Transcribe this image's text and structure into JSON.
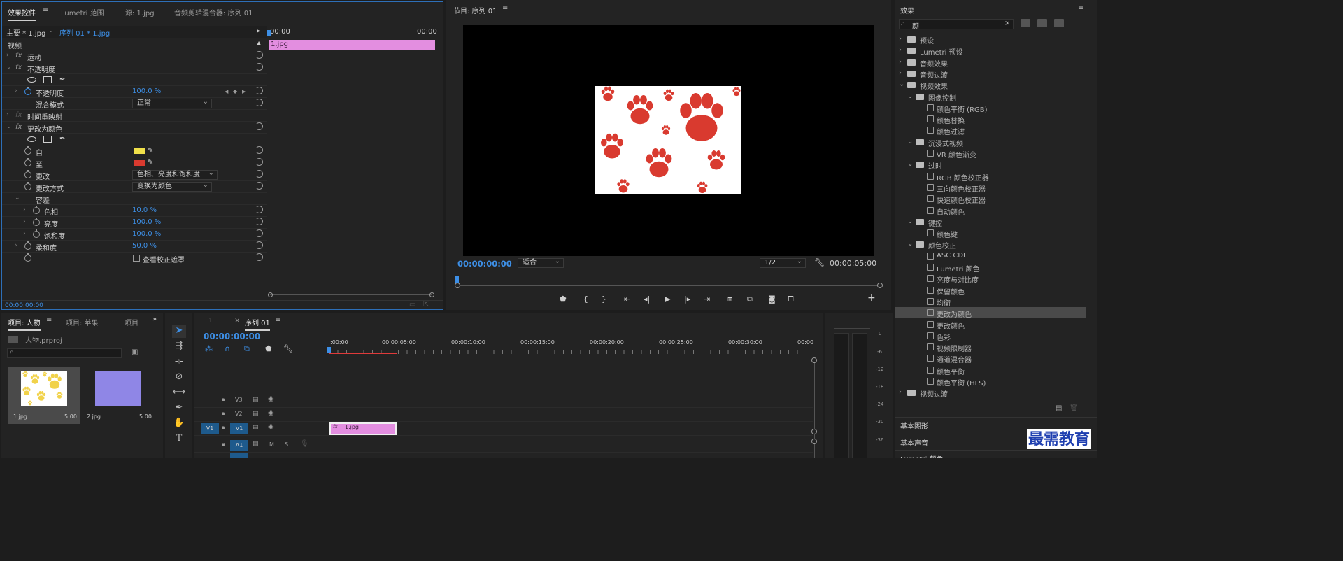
{
  "effect_controls": {
    "tabs": [
      "效果控件",
      "Lumetri 范围",
      "源: 1.jpg",
      "音频剪辑混合器: 序列 01"
    ],
    "master_label": "主要 * 1.jpg",
    "sequence_label": "序列 01 * 1.jpg",
    "section_video": "视频",
    "ruler_start": "00:00",
    "ruler_end": "00:00",
    "clip_name": "1.jpg",
    "motion": "运动",
    "opacity": "不透明度",
    "opacity_param": "不透明度",
    "opacity_value": "100.0 %",
    "blend_mode_label": "混合模式",
    "blend_mode_value": "正常",
    "time_remap": "时间重映射",
    "change_to_color": "更改为颜色",
    "from_label": "自",
    "to_label": "至",
    "from_color": "#f0e04a",
    "to_color": "#d93a2f",
    "change_label": "更改",
    "change_value": "色相、亮度和饱和度",
    "change_by_label": "更改方式",
    "change_by_value": "变换为颜色",
    "tolerance_label": "容差",
    "hue_label": "色相",
    "hue_value": "10.0 %",
    "lightness_label": "亮度",
    "lightness_value": "100.0 %",
    "saturation_label": "饱和度",
    "saturation_value": "100.0 %",
    "softness_label": "柔和度",
    "softness_value": "50.0 %",
    "view_matte_label": "查看校正遮罩",
    "timecode": "00:00:00:00"
  },
  "program_monitor": {
    "title": "节目: 序列 01",
    "timecode_left": "00:00:00:00",
    "fit_value": "适合",
    "resolution_value": "1/2",
    "timecode_right": "00:00:05:00",
    "image_bg": "#ffffff",
    "paw_color": "#d93a2f"
  },
  "project_panel": {
    "tabs": [
      "项目: 人物",
      "项目: 苹果",
      "项目"
    ],
    "project_file": "人物.prproj",
    "items": [
      {
        "name": "1.jpg",
        "duration": "5:00"
      },
      {
        "name": "2.jpg",
        "duration": "5:00"
      }
    ],
    "thumb2_color": "#8f86e6",
    "thumb1_paw_color": "#f1d24a"
  },
  "timeline": {
    "tab_1": "1",
    "tab_seq": "序列 01",
    "timecode": "00:00:00:00",
    "ruler": [
      ":00:00",
      "00:00:05:00",
      "00:00:10:00",
      "00:00:15:00",
      "00:00:20:00",
      "00:00:25:00",
      "00:00:30:00",
      "00:00"
    ],
    "tracks": [
      "V3",
      "V2",
      "V1",
      "A1"
    ],
    "source_v1": "V1",
    "track_m": "M",
    "track_s": "S",
    "clip_name": "1.jpg",
    "clip_fx": "fx"
  },
  "meter": {
    "scale": [
      "0",
      "-6",
      "-12",
      "-18",
      "-24",
      "-30",
      "-36"
    ]
  },
  "effects_panel": {
    "title": "效果",
    "search_value": "颜",
    "tree": [
      {
        "label": "预设",
        "level": 0,
        "kind": "folder-star"
      },
      {
        "label": "Lumetri 预设",
        "level": 0,
        "kind": "folder-star"
      },
      {
        "label": "音频效果",
        "level": 0,
        "kind": "folder"
      },
      {
        "label": "音频过渡",
        "level": 0,
        "kind": "folder"
      },
      {
        "label": "视频效果",
        "level": 0,
        "kind": "folder",
        "open": true
      },
      {
        "label": "图像控制",
        "level": 1,
        "kind": "folder",
        "open": true
      },
      {
        "label": "颜色平衡 (RGB)",
        "level": 2,
        "kind": "effect"
      },
      {
        "label": "颜色替换",
        "level": 2,
        "kind": "effect"
      },
      {
        "label": "颜色过滤",
        "level": 2,
        "kind": "effect"
      },
      {
        "label": "沉浸式视频",
        "level": 1,
        "kind": "folder",
        "open": true
      },
      {
        "label": "VR 颜色渐变",
        "level": 2,
        "kind": "effect"
      },
      {
        "label": "过时",
        "level": 1,
        "kind": "folder",
        "open": true
      },
      {
        "label": "RGB 颜色校正器",
        "level": 2,
        "kind": "effect"
      },
      {
        "label": "三向颜色校正器",
        "level": 2,
        "kind": "effect"
      },
      {
        "label": "快速颜色校正器",
        "level": 2,
        "kind": "effect"
      },
      {
        "label": "自动颜色",
        "level": 2,
        "kind": "effect"
      },
      {
        "label": "键控",
        "level": 1,
        "kind": "folder",
        "open": true
      },
      {
        "label": "颜色键",
        "level": 2,
        "kind": "effect"
      },
      {
        "label": "颜色校正",
        "level": 1,
        "kind": "folder",
        "open": true
      },
      {
        "label": "ASC CDL",
        "level": 2,
        "kind": "effect"
      },
      {
        "label": "Lumetri 颜色",
        "level": 2,
        "kind": "effect"
      },
      {
        "label": "亮度与对比度",
        "level": 2,
        "kind": "effect"
      },
      {
        "label": "保留颜色",
        "level": 2,
        "kind": "effect"
      },
      {
        "label": "均衡",
        "level": 2,
        "kind": "effect"
      },
      {
        "label": "更改为颜色",
        "level": 2,
        "kind": "effect",
        "selected": true
      },
      {
        "label": "更改颜色",
        "level": 2,
        "kind": "effect"
      },
      {
        "label": "色彩",
        "level": 2,
        "kind": "effect"
      },
      {
        "label": "视频限制器",
        "level": 2,
        "kind": "effect"
      },
      {
        "label": "通道混合器",
        "level": 2,
        "kind": "effect"
      },
      {
        "label": "颜色平衡",
        "level": 2,
        "kind": "effect"
      },
      {
        "label": "颜色平衡 (HLS)",
        "level": 2,
        "kind": "effect"
      },
      {
        "label": "视频过渡",
        "level": 0,
        "kind": "folder"
      }
    ],
    "basic_graphics": "基本图形",
    "basic_sound": "基本声音",
    "lumetri_color": "Lumetri 颜色"
  },
  "watermark": "最需教育"
}
